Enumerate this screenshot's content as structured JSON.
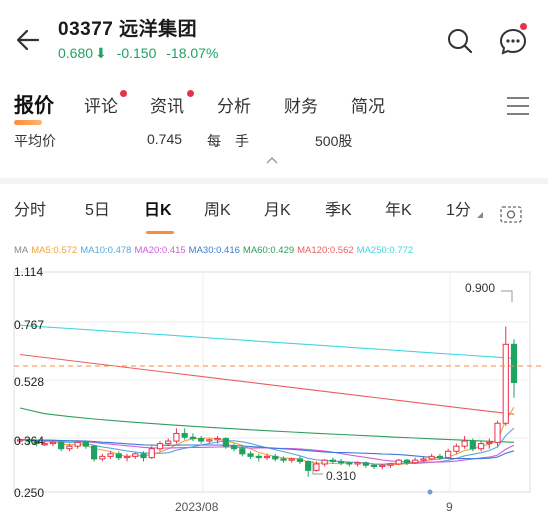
{
  "stock": {
    "title": "03377 远洋集团",
    "price": "0.680",
    "arrow": "⬇",
    "change": "-0.150",
    "change_pct": "-18.07%"
  },
  "colors": {
    "up": "#e8324a",
    "down": "#1fa363",
    "accent": "#ff8a3d"
  },
  "tabs": [
    {
      "label": "报价",
      "active": true
    },
    {
      "label": "评论",
      "dot": true
    },
    {
      "label": "资讯",
      "dot": true
    },
    {
      "label": "分析"
    },
    {
      "label": "财务"
    },
    {
      "label": "简况"
    }
  ],
  "info": {
    "avg_label": "平均价",
    "avg_value": "0.745",
    "lot_label": "每　手",
    "lot_value": "500股"
  },
  "periods": [
    "分时",
    "5日",
    "日K",
    "周K",
    "月K",
    "季K",
    "年K",
    "1分"
  ],
  "active_period": "日K",
  "ma": [
    {
      "label": "MA",
      "color": "#888888"
    },
    {
      "label": "MA5:0.572",
      "color": "#f2a33a"
    },
    {
      "label": "MA10:0.478",
      "color": "#5aa7e0"
    },
    {
      "label": "MA20:0.415",
      "color": "#d45ad8"
    },
    {
      "label": "MA30:0.416",
      "color": "#3b7bd6"
    },
    {
      "label": "MA60:0.429",
      "color": "#2f9e5a"
    },
    {
      "label": "MA120:0.562",
      "color": "#e86060"
    },
    {
      "label": "MA250:0.772",
      "color": "#3fd6e0"
    }
  ],
  "chart_data": {
    "type": "candlestick",
    "y_ticks": [
      "1.114",
      "0.767",
      "0.528",
      "0.364",
      "0.250"
    ],
    "x_ticks": [
      "2023/08",
      "9"
    ],
    "high_label": "0.900",
    "low_label": "0.310",
    "candles": [
      [
        0.45,
        0.455,
        0.44,
        0.46
      ],
      [
        0.455,
        0.45,
        0.44,
        0.46
      ],
      [
        0.45,
        0.44,
        0.43,
        0.455
      ],
      [
        0.44,
        0.44,
        0.43,
        0.45
      ],
      [
        0.44,
        0.445,
        0.43,
        0.45
      ],
      [
        0.445,
        0.42,
        0.41,
        0.45
      ],
      [
        0.42,
        0.43,
        0.41,
        0.44
      ],
      [
        0.43,
        0.445,
        0.42,
        0.45
      ],
      [
        0.445,
        0.43,
        0.42,
        0.45
      ],
      [
        0.43,
        0.38,
        0.37,
        0.435
      ],
      [
        0.38,
        0.39,
        0.37,
        0.4
      ],
      [
        0.39,
        0.4,
        0.38,
        0.41
      ],
      [
        0.4,
        0.385,
        0.375,
        0.41
      ],
      [
        0.385,
        0.39,
        0.37,
        0.4
      ],
      [
        0.39,
        0.4,
        0.38,
        0.405
      ],
      [
        0.4,
        0.385,
        0.37,
        0.41
      ],
      [
        0.385,
        0.42,
        0.38,
        0.43
      ],
      [
        0.42,
        0.44,
        0.41,
        0.45
      ],
      [
        0.44,
        0.45,
        0.43,
        0.46
      ],
      [
        0.45,
        0.48,
        0.44,
        0.5
      ],
      [
        0.48,
        0.465,
        0.455,
        0.5
      ],
      [
        0.465,
        0.46,
        0.45,
        0.48
      ],
      [
        0.46,
        0.45,
        0.44,
        0.47
      ],
      [
        0.45,
        0.455,
        0.44,
        0.46
      ],
      [
        0.455,
        0.46,
        0.44,
        0.47
      ],
      [
        0.46,
        0.43,
        0.42,
        0.465
      ],
      [
        0.43,
        0.42,
        0.41,
        0.44
      ],
      [
        0.42,
        0.4,
        0.39,
        0.43
      ],
      [
        0.4,
        0.39,
        0.38,
        0.41
      ],
      [
        0.39,
        0.385,
        0.37,
        0.4
      ],
      [
        0.385,
        0.39,
        0.375,
        0.4
      ],
      [
        0.39,
        0.38,
        0.37,
        0.4
      ],
      [
        0.38,
        0.375,
        0.365,
        0.39
      ],
      [
        0.375,
        0.38,
        0.365,
        0.385
      ],
      [
        0.38,
        0.37,
        0.36,
        0.39
      ],
      [
        0.37,
        0.335,
        0.31,
        0.375
      ],
      [
        0.335,
        0.36,
        0.33,
        0.37
      ],
      [
        0.36,
        0.375,
        0.35,
        0.38
      ],
      [
        0.375,
        0.37,
        0.36,
        0.385
      ],
      [
        0.37,
        0.365,
        0.355,
        0.38
      ],
      [
        0.365,
        0.36,
        0.35,
        0.37
      ],
      [
        0.36,
        0.365,
        0.35,
        0.37
      ],
      [
        0.365,
        0.355,
        0.345,
        0.37
      ],
      [
        0.355,
        0.35,
        0.34,
        0.36
      ],
      [
        0.35,
        0.355,
        0.34,
        0.36
      ],
      [
        0.355,
        0.36,
        0.345,
        0.365
      ],
      [
        0.36,
        0.375,
        0.355,
        0.38
      ],
      [
        0.375,
        0.365,
        0.355,
        0.38
      ],
      [
        0.365,
        0.375,
        0.36,
        0.385
      ],
      [
        0.375,
        0.38,
        0.37,
        0.39
      ],
      [
        0.38,
        0.39,
        0.375,
        0.4
      ],
      [
        0.39,
        0.385,
        0.375,
        0.4
      ],
      [
        0.385,
        0.41,
        0.38,
        0.42
      ],
      [
        0.41,
        0.43,
        0.4,
        0.44
      ],
      [
        0.43,
        0.45,
        0.42,
        0.47
      ],
      [
        0.45,
        0.42,
        0.41,
        0.46
      ],
      [
        0.42,
        0.44,
        0.41,
        0.45
      ],
      [
        0.44,
        0.445,
        0.42,
        0.46
      ],
      [
        0.445,
        0.52,
        0.43,
        0.53
      ],
      [
        0.52,
        0.83,
        0.51,
        0.9
      ],
      [
        0.83,
        0.68,
        0.62,
        0.85
      ]
    ],
    "ma_lines": {
      "MA250": [
        0.905,
        0.775
      ],
      "MA120": [
        0.79,
        0.555
      ],
      "MA60": [
        0.58,
        0.445
      ],
      "MA30": [
        0.48,
        0.42
      ],
      "MA20": [
        0.46,
        0.415
      ],
      "MA10": [
        0.455,
        0.478
      ],
      "MA5": [
        0.45,
        0.572
      ]
    },
    "price_line": 0.745
  }
}
